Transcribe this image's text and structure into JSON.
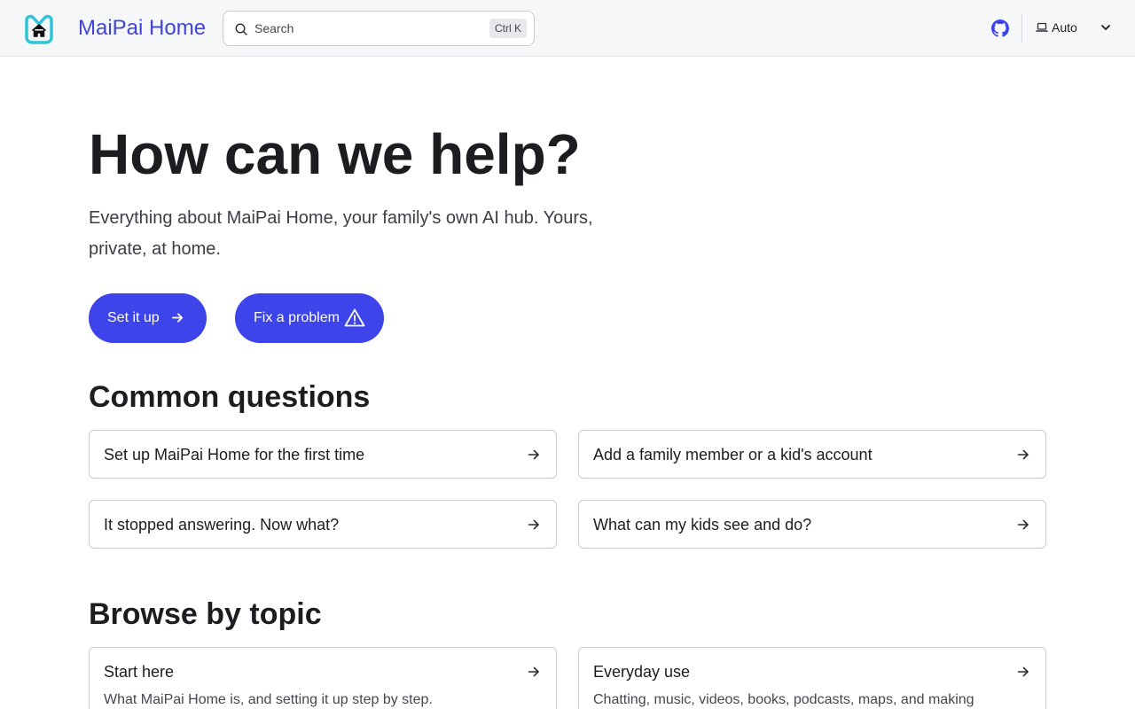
{
  "header": {
    "brand": "MaiPai Home",
    "search": {
      "placeholder": "Search",
      "shortcut": "Ctrl K"
    },
    "theme": {
      "label": "Auto"
    }
  },
  "hero": {
    "title": "How can we help?",
    "subtitle": "Everything about MaiPai Home, your family's own AI hub. Yours, private, at home.",
    "buttons": [
      {
        "label": "Set it up",
        "icon": "arrow-right-icon"
      },
      {
        "label": "Fix a problem",
        "icon": "warning-icon"
      }
    ]
  },
  "common_questions": {
    "title": "Common questions",
    "items": [
      {
        "label": "Set up MaiPai Home for the first time"
      },
      {
        "label": "Add a family member or a kid's account"
      },
      {
        "label": "It stopped answering. Now what?"
      },
      {
        "label": "What can my kids see and do?"
      }
    ]
  },
  "topics": {
    "title": "Browse by topic",
    "items": [
      {
        "label": "Start here",
        "description": "What MaiPai Home is, and setting it up step by step."
      },
      {
        "label": "Everyday use",
        "description": "Chatting, music, videos, books, podcasts, maps, and making"
      }
    ]
  },
  "colors": {
    "accent": "#3d45ea",
    "brand": "#3f45d8",
    "logo": "#2ec5d8"
  }
}
